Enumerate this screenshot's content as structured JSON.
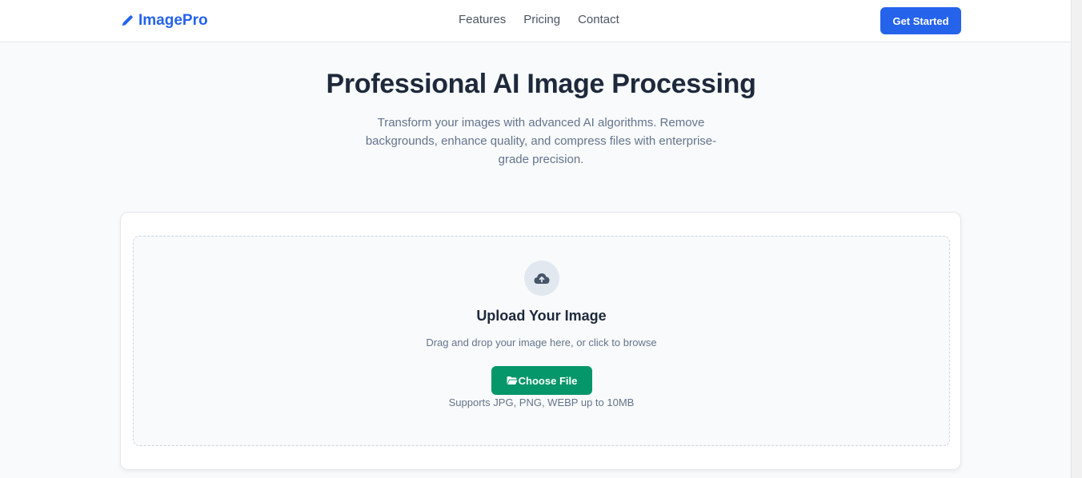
{
  "nav": {
    "brand": "ImagePro",
    "brand_icon": "pen-icon",
    "links": [
      "Features",
      "Pricing",
      "Contact"
    ],
    "cta": "Get Started"
  },
  "hero": {
    "title": "Professional AI Image Processing",
    "subtitle": "Transform your images with advanced AI algorithms. Remove backgrounds, enhance quality, and compress files with enterprise-grade precision."
  },
  "upload": {
    "icon": "cloud-upload-icon",
    "title": "Upload Your Image",
    "description": "Drag and drop your image here, or click to browse",
    "button_icon": "folder-open-icon",
    "button": "Choose File",
    "note": "Supports JPG, PNG, WEBP up to 10MB"
  },
  "colors": {
    "primary": "#2563eb",
    "success": "#059669",
    "heading": "#1e293b",
    "muted": "#64748b",
    "background": "#f8fafc"
  }
}
